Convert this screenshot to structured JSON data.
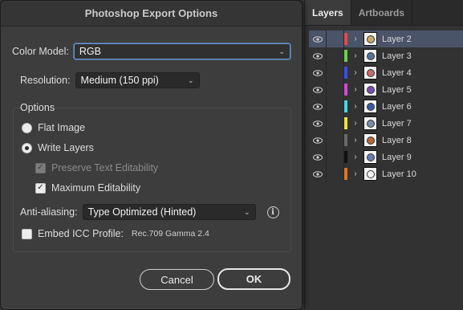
{
  "dialog": {
    "title": "Photoshop Export Options",
    "color_model": {
      "label": "Color Model:",
      "value": "RGB"
    },
    "resolution": {
      "label": "Resolution:",
      "value": "Medium (150 ppi)"
    },
    "options": {
      "label": "Options",
      "flat_image": {
        "label": "Flat Image",
        "selected": false
      },
      "write_layers": {
        "label": "Write Layers",
        "selected": true
      },
      "preserve_text": {
        "label": "Preserve Text Editability",
        "checked": true,
        "disabled": true
      },
      "max_edit": {
        "label": "Maximum Editability",
        "checked": true
      }
    },
    "anti_aliasing": {
      "label": "Anti-aliasing:",
      "value": "Type Optimized (Hinted)"
    },
    "icc": {
      "label": "Embed ICC Profile:",
      "value": "Rec.709 Gamma 2.4",
      "checked": false
    },
    "cancel_label": "Cancel",
    "ok_label": "OK"
  },
  "layers_panel": {
    "tabs": [
      "Layers",
      "Artboards"
    ],
    "layers": [
      {
        "name": "Layer 2",
        "color": "#e24a4a",
        "thumb": "#c9a86a",
        "selected": true
      },
      {
        "name": "Layer 3",
        "color": "#6bd04a",
        "thumb": "#5a6f9a"
      },
      {
        "name": "Layer 4",
        "color": "#3b4fe0",
        "thumb": "#c56a6a"
      },
      {
        "name": "Layer 5",
        "color": "#d04ad0",
        "thumb": "#7a4fb0"
      },
      {
        "name": "Layer 6",
        "color": "#4ad6e0",
        "thumb": "#3a5aa0"
      },
      {
        "name": "Layer 7",
        "color": "#e8e04a",
        "thumb": "#7a8aa8"
      },
      {
        "name": "Layer 8",
        "color": "#6a6a6a",
        "thumb": "#b06a3a"
      },
      {
        "name": "Layer 9",
        "color": "#111111",
        "thumb": "#6a7ab0"
      },
      {
        "name": "Layer 10",
        "color": "#e0742a",
        "thumb": "#f4f4f4"
      }
    ]
  }
}
